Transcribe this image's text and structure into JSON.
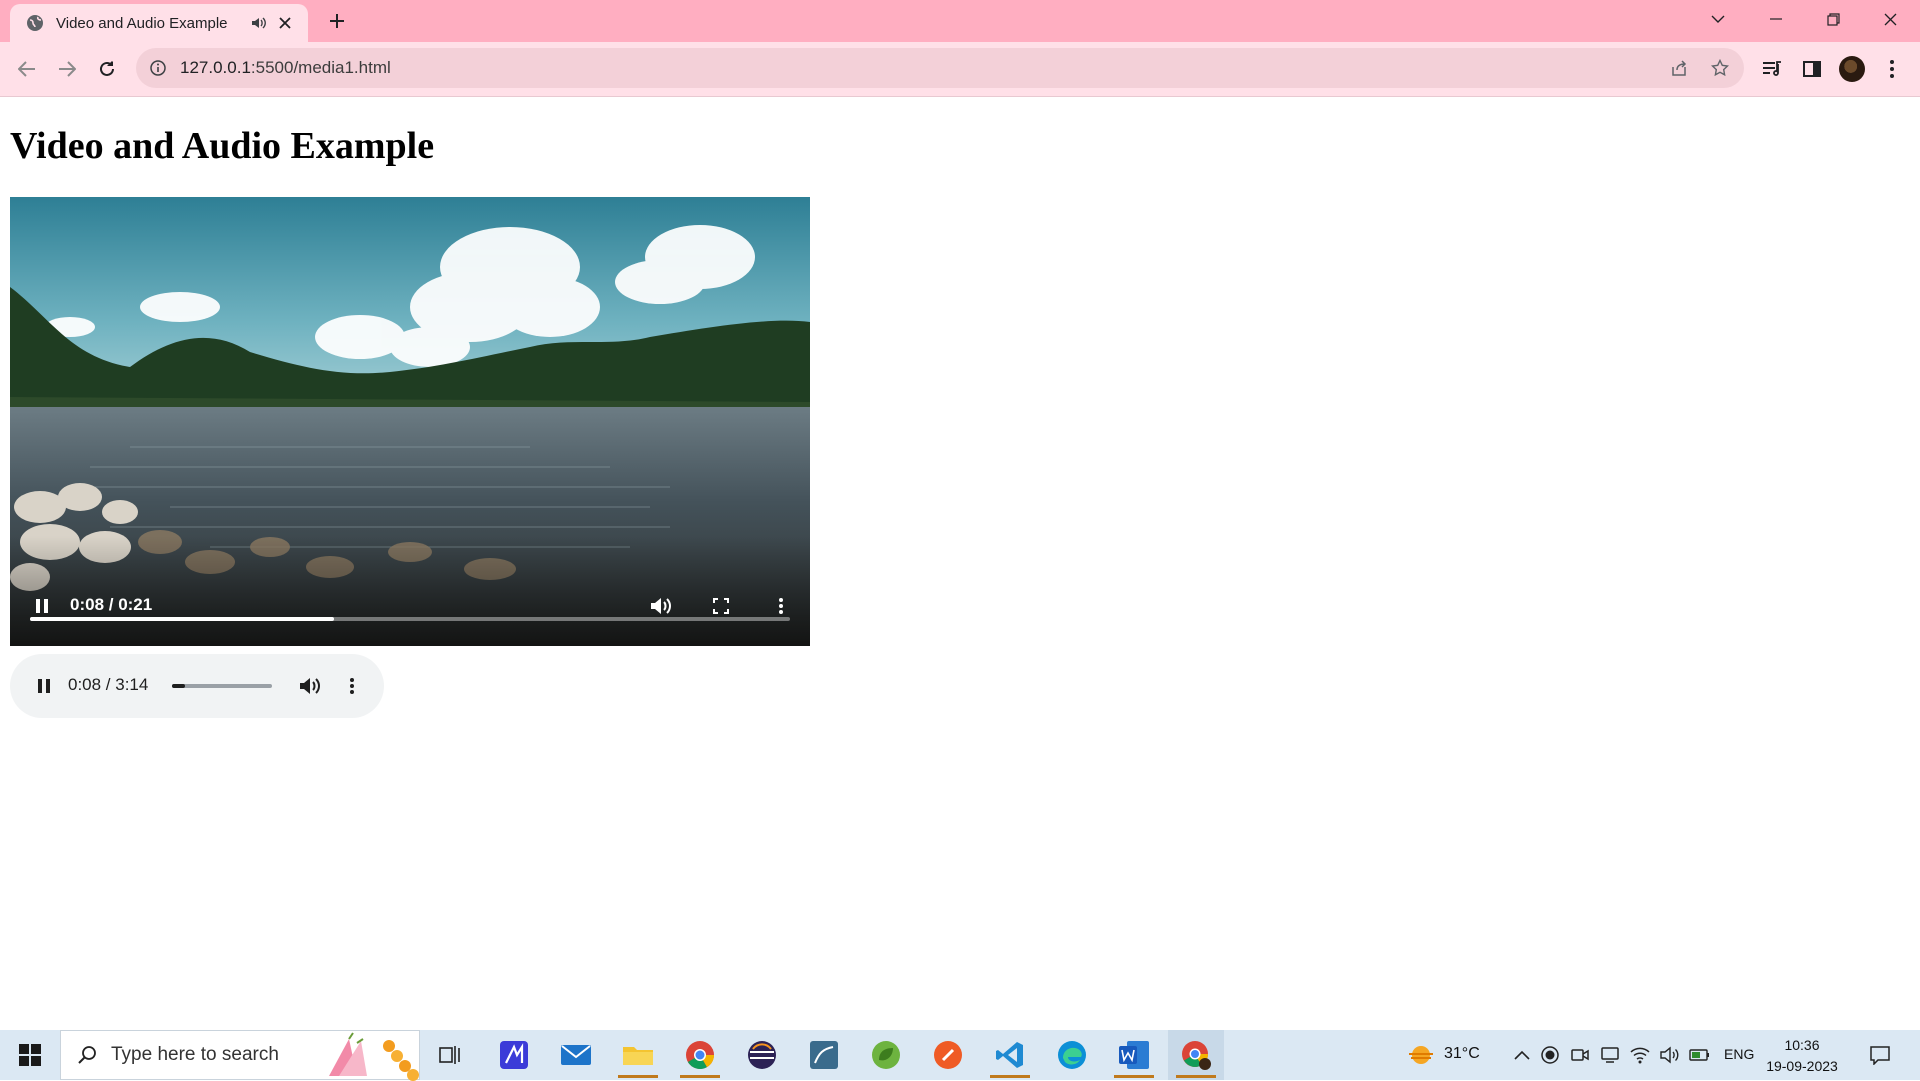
{
  "browser": {
    "tab": {
      "title": "Video and Audio Example"
    },
    "address": {
      "host": "127.0.0.1",
      "path": ":5500/media1.html"
    }
  },
  "page": {
    "heading": "Video and Audio Example",
    "video": {
      "time_display": "0:08 / 0:21",
      "progress_fraction": 0.4
    },
    "audio": {
      "time_display": "0:08 / 3:14",
      "progress_fraction": 0.13
    }
  },
  "taskbar": {
    "search_placeholder": "Type here to search",
    "weather": "31°C",
    "language": "ENG",
    "clock_time": "10:36",
    "clock_date": "19-09-2023"
  },
  "colors": {
    "tabbar": "#ffaec1",
    "toolbar": "#ffe0e8",
    "taskbar": "#dbe8f3"
  }
}
